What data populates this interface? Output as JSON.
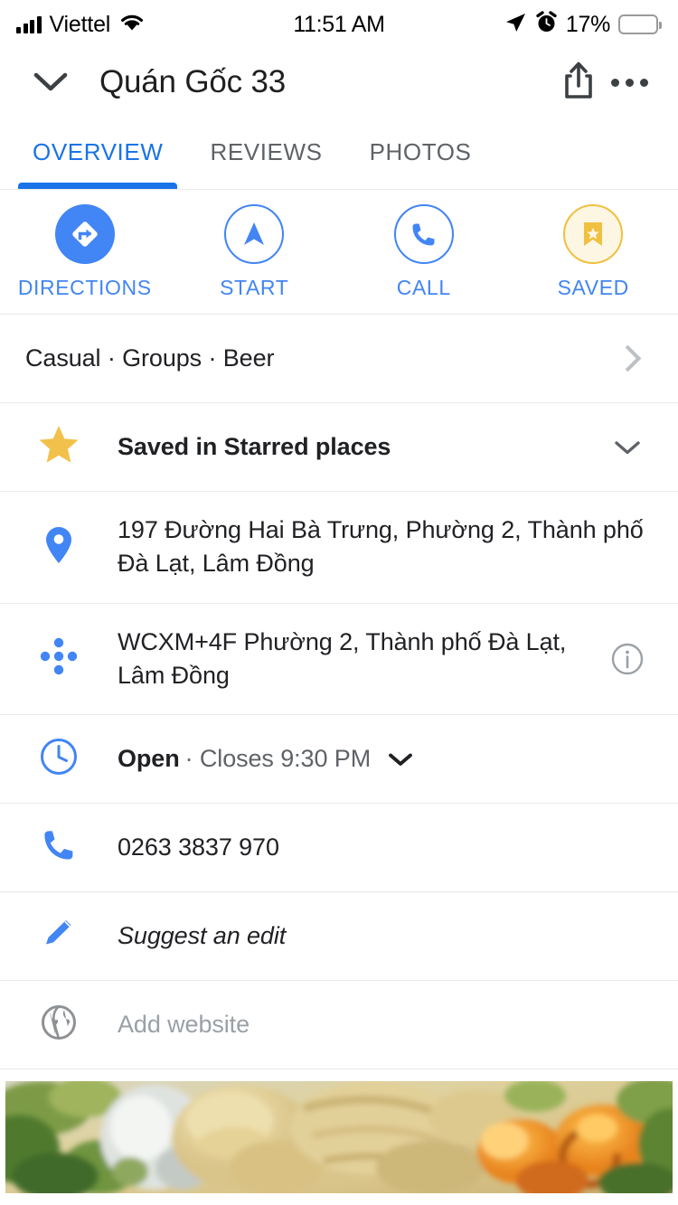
{
  "status_bar": {
    "carrier": "Viettel",
    "time": "11:51 AM",
    "battery_percent": "17%",
    "battery_level": 17,
    "icons": [
      "signal-bars-icon",
      "wifi-icon",
      "location-arrow-icon",
      "alarm-clock-icon",
      "battery-icon"
    ]
  },
  "header": {
    "title": "Quán Gốc 33",
    "back_icon": "chevron-down-icon",
    "share_icon": "share-icon",
    "overflow_icon": "more-horizontal-icon"
  },
  "tabs": [
    {
      "label": "OVERVIEW",
      "active": true
    },
    {
      "label": "REVIEWS",
      "active": false
    },
    {
      "label": "PHOTOS",
      "active": false
    }
  ],
  "actions": [
    {
      "label": "DIRECTIONS",
      "icon": "directions-icon",
      "style": "filled"
    },
    {
      "label": "START",
      "icon": "navigation-arrow-icon",
      "style": "outline"
    },
    {
      "label": "CALL",
      "icon": "phone-icon",
      "style": "outline"
    },
    {
      "label": "SAVED",
      "icon": "bookmark-star-icon",
      "style": "saved"
    }
  ],
  "rows": {
    "categories": {
      "text": "Casual · Groups · Beer",
      "trailing_icon": "chevron-right-icon"
    },
    "saved": {
      "text": "Saved in Starred places",
      "icon": "star-icon",
      "trailing_icon": "chevron-down-icon"
    },
    "address": {
      "text": "197 Đường Hai Bà Trưng, Phường 2, Thành phố Đà Lạt, Lâm Đồng",
      "icon": "map-pin-icon"
    },
    "plus_code": {
      "text": "WCXM+4F Phường 2, Thành phố Đà Lạt, Lâm Đồng",
      "icon": "plus-code-icon",
      "trailing_icon": "info-icon"
    },
    "hours": {
      "status": "Open",
      "detail": "· Closes 9:30 PM",
      "icon": "clock-icon",
      "trailing_icon": "chevron-down-icon"
    },
    "phone": {
      "text": "0263 3837 970",
      "icon": "phone-icon"
    },
    "suggest_edit": {
      "text": "Suggest an edit",
      "icon": "pencil-icon"
    },
    "website": {
      "text": "Add website",
      "icon": "globe-icon"
    }
  },
  "photo": {
    "alt": "food-photo-wonton-noodle-soup"
  },
  "colors": {
    "accent_blue": "#4285f4",
    "tab_blue": "#1a73e8",
    "saved_gold": "#f0c040",
    "star_gold": "#f2c14b",
    "text_primary": "#202124",
    "text_secondary": "#5f6368",
    "text_muted": "#9aa0a6",
    "battery_red": "#f5352b",
    "divider": "#e8eaed"
  }
}
